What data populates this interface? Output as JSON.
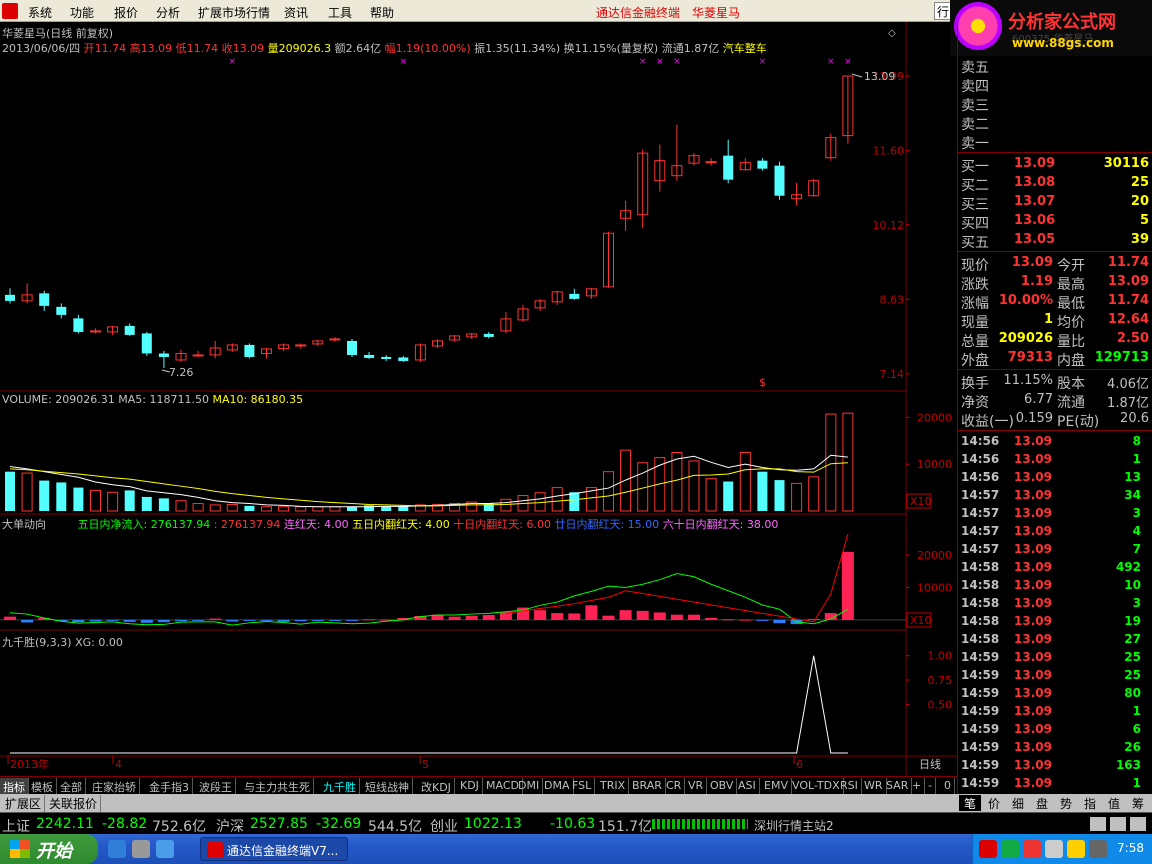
{
  "menu": {
    "items": [
      "系统",
      "功能",
      "报价",
      "分析",
      "扩展市场行情",
      "资讯",
      "工具",
      "帮助"
    ],
    "app_title": "通达信金融终端",
    "stock_title": "华菱星马",
    "right_btn": "行"
  },
  "brand": {
    "title": "分析家公式网",
    "url": "www.88gs.com",
    "faded_code": "600375 华菱星马"
  },
  "chart": {
    "header1": "华菱星马(日线 前复权)",
    "header2": {
      "date": "2013/06/06/四",
      "open": "开11.74",
      "high": "高13.09",
      "low": "低11.74",
      "close": "收13.09",
      "vol": "量209026.3",
      "amt": "额2.64亿",
      "rise": "幅1.19(10.00%)",
      "amp": "振1.35(11.34%)",
      "turn": "换11.15%(量复权)",
      "float": "流通1.87亿",
      "sector": "汽车整车"
    },
    "price_axis": [
      "13.09",
      "11.60",
      "10.12",
      "8.63",
      "7.14"
    ],
    "price_labels": {
      "high": "13.09",
      "low": "7.26"
    },
    "vol_header": {
      "name": "VOLUME: 209026.31",
      "ma5": "MA5: 118711.50",
      "ma10": "MA10: 86180.35"
    },
    "vol_axis": [
      "20000",
      "10000",
      "X10"
    ],
    "flow_header": {
      "name": "大单动向",
      "a": "五日内净流入: 276137.94",
      "b": ": 276137.94",
      "c": "连红天: 4.00",
      "d": "五日内翻红天: 4.00",
      "e": "十日内翻红天: 6.00",
      "f": "廿日内翻红天: 15.00",
      "g": "六十日内翻红天: 38.00"
    },
    "flow_axis": [
      "20000",
      "10000",
      "X10"
    ],
    "jqs_header": "九千胜(9,3,3) XG: 0.00",
    "jqs_axis": [
      "1.00",
      "0.75",
      "0.50"
    ],
    "date_axis": [
      "2013年",
      "4",
      "5",
      "6"
    ],
    "period": "日线"
  },
  "chart_data": {
    "type": "candlestick",
    "candles": [
      {
        "o": 8.72,
        "c": 8.6,
        "h": 8.85,
        "l": 8.55
      },
      {
        "o": 8.6,
        "c": 8.72,
        "h": 8.95,
        "l": 8.55
      },
      {
        "o": 8.75,
        "c": 8.5,
        "h": 8.8,
        "l": 8.4
      },
      {
        "o": 8.48,
        "c": 8.32,
        "h": 8.55,
        "l": 8.25
      },
      {
        "o": 8.25,
        "c": 7.98,
        "h": 8.32,
        "l": 7.95
      },
      {
        "o": 7.99,
        "c": 8.0,
        "h": 8.05,
        "l": 7.95
      },
      {
        "o": 7.98,
        "c": 8.08,
        "h": 8.1,
        "l": 7.92
      },
      {
        "o": 8.1,
        "c": 7.92,
        "h": 8.15,
        "l": 7.9
      },
      {
        "o": 7.95,
        "c": 7.55,
        "h": 7.98,
        "l": 7.5
      },
      {
        "o": 7.55,
        "c": 7.48,
        "h": 7.6,
        "l": 7.26
      },
      {
        "o": 7.42,
        "c": 7.55,
        "h": 7.62,
        "l": 7.38
      },
      {
        "o": 7.52,
        "c": 7.52,
        "h": 7.6,
        "l": 7.48
      },
      {
        "o": 7.52,
        "c": 7.66,
        "h": 7.8,
        "l": 7.45
      },
      {
        "o": 7.62,
        "c": 7.72,
        "h": 7.75,
        "l": 7.58
      },
      {
        "o": 7.72,
        "c": 7.48,
        "h": 7.75,
        "l": 7.45
      },
      {
        "o": 7.55,
        "c": 7.64,
        "h": 7.66,
        "l": 7.45
      },
      {
        "o": 7.65,
        "c": 7.72,
        "h": 7.75,
        "l": 7.6
      },
      {
        "o": 7.7,
        "c": 7.72,
        "h": 7.75,
        "l": 7.65
      },
      {
        "o": 7.74,
        "c": 7.8,
        "h": 7.82,
        "l": 7.7
      },
      {
        "o": 7.82,
        "c": 7.84,
        "h": 7.88,
        "l": 7.78
      },
      {
        "o": 7.8,
        "c": 7.52,
        "h": 7.84,
        "l": 7.48
      },
      {
        "o": 7.52,
        "c": 7.46,
        "h": 7.58,
        "l": 7.44
      },
      {
        "o": 7.48,
        "c": 7.44,
        "h": 7.52,
        "l": 7.4
      },
      {
        "o": 7.47,
        "c": 7.4,
        "h": 7.5,
        "l": 7.38
      },
      {
        "o": 7.42,
        "c": 7.72,
        "h": 7.75,
        "l": 7.38
      },
      {
        "o": 7.7,
        "c": 7.8,
        "h": 7.83,
        "l": 7.66
      },
      {
        "o": 7.82,
        "c": 7.9,
        "h": 7.92,
        "l": 7.78
      },
      {
        "o": 7.88,
        "c": 7.94,
        "h": 7.96,
        "l": 7.84
      },
      {
        "o": 7.94,
        "c": 7.88,
        "h": 7.98,
        "l": 7.85
      },
      {
        "o": 8.0,
        "c": 8.24,
        "h": 8.38,
        "l": 7.95
      },
      {
        "o": 8.22,
        "c": 8.44,
        "h": 8.52,
        "l": 8.18
      },
      {
        "o": 8.46,
        "c": 8.6,
        "h": 8.64,
        "l": 8.4
      },
      {
        "o": 8.58,
        "c": 8.78,
        "h": 8.8,
        "l": 8.52
      },
      {
        "o": 8.74,
        "c": 8.64,
        "h": 8.84,
        "l": 8.62
      },
      {
        "o": 8.7,
        "c": 8.84,
        "h": 8.86,
        "l": 8.64
      },
      {
        "o": 8.88,
        "c": 9.95,
        "h": 9.98,
        "l": 8.86
      },
      {
        "o": 10.25,
        "c": 10.4,
        "h": 10.6,
        "l": 10.0
      },
      {
        "o": 10.32,
        "c": 11.55,
        "h": 11.62,
        "l": 10.05
      },
      {
        "o": 11.0,
        "c": 11.4,
        "h": 11.72,
        "l": 10.78
      },
      {
        "o": 11.1,
        "c": 11.3,
        "h": 12.12,
        "l": 11.0
      },
      {
        "o": 11.35,
        "c": 11.5,
        "h": 11.55,
        "l": 11.3
      },
      {
        "o": 11.38,
        "c": 11.38,
        "h": 11.45,
        "l": 11.3
      },
      {
        "o": 11.5,
        "c": 11.02,
        "h": 11.82,
        "l": 10.95
      },
      {
        "o": 11.22,
        "c": 11.36,
        "h": 11.45,
        "l": 11.2
      },
      {
        "o": 11.4,
        "c": 11.24,
        "h": 11.45,
        "l": 11.2
      },
      {
        "o": 11.3,
        "c": 10.7,
        "h": 11.38,
        "l": 10.62
      },
      {
        "o": 10.64,
        "c": 10.72,
        "h": 10.96,
        "l": 10.5
      },
      {
        "o": 10.7,
        "c": 11.0,
        "h": 11.04,
        "l": 10.68
      },
      {
        "o": 11.46,
        "c": 11.86,
        "h": 11.94,
        "l": 11.4
      },
      {
        "o": 11.9,
        "c": 13.09,
        "h": 13.09,
        "l": 11.74
      }
    ],
    "volume": [
      8400,
      8100,
      6500,
      6100,
      5000,
      4400,
      4000,
      4400,
      3000,
      2700,
      2200,
      1600,
      1300,
      1400,
      1100,
      900,
      900,
      900,
      900,
      900,
      900,
      1200,
      1000,
      1000,
      1300,
      1400,
      1600,
      1900,
      1600,
      2500,
      3300,
      3900,
      5000,
      4000,
      5000,
      8400,
      13000,
      10300,
      11400,
      12500,
      10700,
      6900,
      6300,
      12500,
      8400,
      6600,
      5900,
      7300,
      20700,
      20900
    ],
    "ma5": [
      9500,
      9000,
      8400,
      7800,
      7200,
      6200,
      5600,
      5200,
      4300,
      3900,
      3500,
      2900,
      2200,
      1800,
      1600,
      1300,
      1200,
      1000,
      900,
      900,
      900,
      900,
      1000,
      1000,
      1100,
      1200,
      1400,
      1600,
      1600,
      1800,
      2200,
      2600,
      3200,
      3700,
      4300,
      4900,
      6600,
      8100,
      9800,
      11100,
      11700,
      10400,
      9300,
      10000,
      9300,
      8800,
      8700,
      9000,
      11900,
      11500
    ],
    "ma10": [
      9000,
      8800,
      8500,
      8200,
      7900,
      7500,
      7100,
      6800,
      6300,
      5800,
      5300,
      4800,
      4200,
      3700,
      3300,
      2900,
      2600,
      2300,
      2000,
      1800,
      1600,
      1400,
      1300,
      1200,
      1100,
      1100,
      1200,
      1300,
      1300,
      1400,
      1600,
      1800,
      2100,
      2400,
      2800,
      3200,
      4000,
      4900,
      5800,
      6600,
      7600,
      7700,
      7900,
      8800,
      9000,
      9000,
      8400,
      8300,
      10100,
      10300
    ],
    "flow_line": [
      2200,
      1800,
      600,
      -400,
      -1000,
      -800,
      -600,
      -1200,
      -1500,
      -1400,
      -700,
      -600,
      -600,
      -1600,
      -900,
      -500,
      -800,
      -1300,
      -700,
      -900,
      -1200,
      -1000,
      -400,
      0,
      1000,
      1500,
      1500,
      1800,
      2000,
      2500,
      3000,
      4500,
      5500,
      7400,
      8800,
      10400,
      10000,
      11000,
      12400,
      14300,
      13300,
      11000,
      9000,
      7000,
      4600,
      3300,
      -600,
      -1200,
      300,
      3300
    ],
    "flow_red_line": [
      null,
      null,
      null,
      null,
      null,
      null,
      null,
      null,
      null,
      null,
      null,
      null,
      null,
      null,
      null,
      null,
      null,
      null,
      null,
      null,
      null,
      null,
      null,
      null,
      null,
      null,
      null,
      null,
      null,
      2000,
      2800,
      3500,
      4200,
      5000,
      6000,
      7000,
      9000,
      null,
      null,
      null,
      null,
      null,
      null,
      null,
      null,
      null,
      null,
      -600,
      8000,
      26500
    ],
    "flow_bars": [
      1000,
      -800,
      600,
      -400,
      -700,
      -500,
      -300,
      -600,
      -900,
      -700,
      -400,
      -300,
      400,
      -500,
      -300,
      -200,
      -600,
      -400,
      -300,
      -200,
      -200,
      200,
      100,
      600,
      1200,
      1600,
      1000,
      1300,
      1500,
      2400,
      3800,
      3000,
      2100,
      2000,
      4500,
      1300,
      3000,
      2800,
      2300,
      1600,
      1600,
      600,
      200,
      100,
      -300,
      -1000,
      -1300,
      300,
      2100,
      21000
    ],
    "jqs": [
      0,
      0,
      0,
      0,
      0,
      0,
      0,
      0,
      0,
      0,
      0,
      0,
      0,
      0,
      0,
      0,
      0,
      0,
      0,
      0,
      0,
      0,
      0,
      0,
      0,
      0,
      0,
      0,
      0,
      0,
      0,
      0,
      0,
      0,
      0,
      0,
      0,
      0,
      0,
      0,
      0,
      0,
      0,
      0,
      0,
      0,
      0,
      1,
      0,
      0
    ],
    "marks_x": [
      13,
      23,
      37,
      38,
      39,
      44,
      48,
      49
    ],
    "price_range": [
      6.9,
      13.45
    ],
    "vol_range": [
      0,
      22000
    ],
    "flow_range": [
      -2500,
      26500
    ],
    "jqs_range": [
      0,
      1.1
    ]
  },
  "quote": {
    "asks": [
      {
        "l": "卖五",
        "p": "",
        "v": ""
      },
      {
        "l": "卖四",
        "p": "",
        "v": ""
      },
      {
        "l": "卖三",
        "p": "",
        "v": ""
      },
      {
        "l": "卖二",
        "p": "",
        "v": ""
      },
      {
        "l": "卖一",
        "p": "",
        "v": ""
      }
    ],
    "bids": [
      {
        "l": "买一",
        "p": "13.09",
        "v": "30116"
      },
      {
        "l": "买二",
        "p": "13.08",
        "v": "25"
      },
      {
        "l": "买三",
        "p": "13.07",
        "v": "20"
      },
      {
        "l": "买四",
        "p": "13.06",
        "v": "5"
      },
      {
        "l": "买五",
        "p": "13.05",
        "v": "39"
      }
    ],
    "stats": [
      {
        "l1": "现价",
        "v1": "13.09",
        "l2": "今开",
        "v2": "11.74",
        "c1": "#ff3333",
        "c2": "#ff3333"
      },
      {
        "l1": "涨跌",
        "v1": "1.19",
        "l2": "最高",
        "v2": "13.09",
        "c1": "#ff3333",
        "c2": "#ff3333"
      },
      {
        "l1": "涨幅",
        "v1": "10.00%",
        "l2": "最低",
        "v2": "11.74",
        "c1": "#ff3333",
        "c2": "#ff3333"
      },
      {
        "l1": "现量",
        "v1": "1",
        "l2": "均价",
        "v2": "12.64",
        "c1": "#ffff00",
        "c2": "#ff3333"
      },
      {
        "l1": "总量",
        "v1": "209026",
        "l2": "量比",
        "v2": "2.50",
        "c1": "#ffff00",
        "c2": "#ff3333"
      },
      {
        "l1": "外盘",
        "v1": "79313",
        "l2": "内盘",
        "v2": "129713",
        "c1": "#ff3333",
        "c2": "#00ff00"
      }
    ],
    "stats2": [
      {
        "l1": "换手",
        "v1": "11.15%",
        "l2": "股本",
        "v2": "4.06亿"
      },
      {
        "l1": "净资",
        "v1": "6.77",
        "l2": "流通",
        "v2": "1.87亿"
      },
      {
        "l1": "收益(一)",
        "v1": "0.159",
        "l2": "PE(动)",
        "v2": "20.6"
      }
    ],
    "ticks": [
      {
        "t": "14:56",
        "p": "13.09",
        "v": "8",
        "c": "#00ff00"
      },
      {
        "t": "14:56",
        "p": "13.09",
        "v": "1",
        "c": "#00ff00"
      },
      {
        "t": "14:56",
        "p": "13.09",
        "v": "13",
        "c": "#00ff00"
      },
      {
        "t": "14:57",
        "p": "13.09",
        "v": "34",
        "c": "#00ff00"
      },
      {
        "t": "14:57",
        "p": "13.09",
        "v": "3",
        "c": "#00ff00"
      },
      {
        "t": "14:57",
        "p": "13.09",
        "v": "4",
        "c": "#00ff00"
      },
      {
        "t": "14:57",
        "p": "13.09",
        "v": "7",
        "c": "#00ff00"
      },
      {
        "t": "14:58",
        "p": "13.09",
        "v": "492",
        "c": "#00ff00"
      },
      {
        "t": "14:58",
        "p": "13.09",
        "v": "10",
        "c": "#00ff00"
      },
      {
        "t": "14:58",
        "p": "13.09",
        "v": "3",
        "c": "#00ff00"
      },
      {
        "t": "14:58",
        "p": "13.09",
        "v": "19",
        "c": "#00ff00"
      },
      {
        "t": "14:58",
        "p": "13.09",
        "v": "27",
        "c": "#00ff00"
      },
      {
        "t": "14:59",
        "p": "13.09",
        "v": "25",
        "c": "#00ff00"
      },
      {
        "t": "14:59",
        "p": "13.09",
        "v": "25",
        "c": "#00ff00"
      },
      {
        "t": "14:59",
        "p": "13.09",
        "v": "80",
        "c": "#00ff00"
      },
      {
        "t": "14:59",
        "p": "13.09",
        "v": "1",
        "c": "#00ff00"
      },
      {
        "t": "14:59",
        "p": "13.09",
        "v": "6",
        "c": "#00ff00"
      },
      {
        "t": "14:59",
        "p": "13.09",
        "v": "26",
        "c": "#00ff00"
      },
      {
        "t": "14:59",
        "p": "13.09",
        "v": "163",
        "c": "#00ff00"
      },
      {
        "t": "14:59",
        "p": "13.09",
        "v": "1",
        "c": "#00ff00"
      }
    ]
  },
  "indicator_tabs": [
    "指标",
    "模板",
    "全部",
    "庄家抬轿",
    "金手指3",
    "波段王",
    "与主力共生死",
    "九千胜",
    "短线战神",
    "改KDJ",
    "KDJ",
    "MACD",
    "DMI",
    "DMA",
    "FSL",
    "TRIX",
    "BRAR",
    "CR",
    "VR",
    "OBV",
    "ASI",
    "EMV",
    "VOL-TDX",
    "RSI",
    "WR",
    "SAR",
    "+",
    "-",
    "0"
  ],
  "ext_tabs": [
    "扩展区",
    "关联报价"
  ],
  "right_tabs": [
    "笔",
    "价",
    "细",
    "盘",
    "势",
    "指",
    "值",
    "筹"
  ],
  "index_bar": {
    "sh": "上证",
    "sh_v": "2242.11",
    "sh_c": "-28.82",
    "sh_a": "752.6亿",
    "hs": "沪深",
    "hs_v": "2527.85",
    "hs_c": "-32.69",
    "hs_a": "544.5亿",
    "cy": "创业",
    "cy_v": "1022.13",
    "cy_c": "-10.63",
    "cy_a": "151.7亿",
    "server": "深圳行情主站2"
  },
  "taskbar": {
    "start": "开始",
    "task": "通达信金融终端V7...",
    "clock": "7:58"
  }
}
